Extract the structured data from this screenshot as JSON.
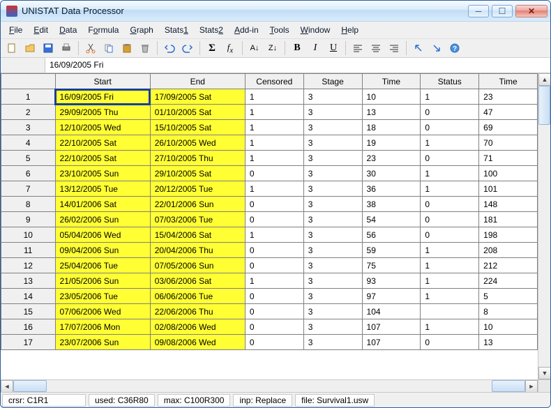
{
  "title": "UNISTAT Data Processor",
  "menu": [
    "File",
    "Edit",
    "Data",
    "Formula",
    "Graph",
    "Stats1",
    "Stats2",
    "Add-in",
    "Tools",
    "Window",
    "Help"
  ],
  "menu_ul": [
    "F",
    "E",
    "D",
    "o",
    "G",
    "1",
    "2",
    "A",
    "T",
    "W",
    "H"
  ],
  "formula_bar": "16/09/2005 Fri",
  "columns": [
    "Start",
    "End",
    "Censored",
    "Stage",
    "Time",
    "Status",
    "Time"
  ],
  "rows": [
    {
      "n": "1",
      "start": "16/09/2005 Fri",
      "end": "17/09/2005 Sat",
      "cen": "1",
      "stage": "3",
      "t1": "10",
      "status": "1",
      "t2": "23"
    },
    {
      "n": "2",
      "start": "29/09/2005 Thu",
      "end": "01/10/2005 Sat",
      "cen": "1",
      "stage": "3",
      "t1": "13",
      "status": "0",
      "t2": "47"
    },
    {
      "n": "3",
      "start": "12/10/2005 Wed",
      "end": "15/10/2005 Sat",
      "cen": "1",
      "stage": "3",
      "t1": "18",
      "status": "0",
      "t2": "69"
    },
    {
      "n": "4",
      "start": "22/10/2005 Sat",
      "end": "26/10/2005 Wed",
      "cen": "1",
      "stage": "3",
      "t1": "19",
      "status": "1",
      "t2": "70"
    },
    {
      "n": "5",
      "start": "22/10/2005 Sat",
      "end": "27/10/2005 Thu",
      "cen": "1",
      "stage": "3",
      "t1": "23",
      "status": "0",
      "t2": "71"
    },
    {
      "n": "6",
      "start": "23/10/2005 Sun",
      "end": "29/10/2005 Sat",
      "cen": "0",
      "stage": "3",
      "t1": "30",
      "status": "1",
      "t2": "100"
    },
    {
      "n": "7",
      "start": "13/12/2005 Tue",
      "end": "20/12/2005 Tue",
      "cen": "1",
      "stage": "3",
      "t1": "36",
      "status": "1",
      "t2": "101"
    },
    {
      "n": "8",
      "start": "14/01/2006 Sat",
      "end": "22/01/2006 Sun",
      "cen": "0",
      "stage": "3",
      "t1": "38",
      "status": "0",
      "t2": "148"
    },
    {
      "n": "9",
      "start": "26/02/2006 Sun",
      "end": "07/03/2006 Tue",
      "cen": "0",
      "stage": "3",
      "t1": "54",
      "status": "0",
      "t2": "181"
    },
    {
      "n": "10",
      "start": "05/04/2006 Wed",
      "end": "15/04/2006 Sat",
      "cen": "1",
      "stage": "3",
      "t1": "56",
      "status": "0",
      "t2": "198"
    },
    {
      "n": "11",
      "start": "09/04/2006 Sun",
      "end": "20/04/2006 Thu",
      "cen": "0",
      "stage": "3",
      "t1": "59",
      "status": "1",
      "t2": "208"
    },
    {
      "n": "12",
      "start": "25/04/2006 Tue",
      "end": "07/05/2006 Sun",
      "cen": "0",
      "stage": "3",
      "t1": "75",
      "status": "1",
      "t2": "212"
    },
    {
      "n": "13",
      "start": "21/05/2006 Sun",
      "end": "03/06/2006 Sat",
      "cen": "1",
      "stage": "3",
      "t1": "93",
      "status": "1",
      "t2": "224"
    },
    {
      "n": "14",
      "start": "23/05/2006 Tue",
      "end": "06/06/2006 Tue",
      "cen": "0",
      "stage": "3",
      "t1": "97",
      "status": "1",
      "t2": "5"
    },
    {
      "n": "15",
      "start": "07/06/2006 Wed",
      "end": "22/06/2006 Thu",
      "cen": "0",
      "stage": "3",
      "t1": "104",
      "status": "",
      "t2": "8"
    },
    {
      "n": "16",
      "start": "17/07/2006 Mon",
      "end": "02/08/2006 Wed",
      "cen": "0",
      "stage": "3",
      "t1": "107",
      "status": "1",
      "t2": "10"
    },
    {
      "n": "17",
      "start": "23/07/2006 Sun",
      "end": "09/08/2006 Wed",
      "cen": "0",
      "stage": "3",
      "t1": "107",
      "status": "0",
      "t2": "13"
    }
  ],
  "status": {
    "crsr": "crsr: C1R1",
    "used": "used: C36R80",
    "max": "max: C100R300",
    "inp": "inp: Replace",
    "file": "file: Survival1.usw"
  }
}
